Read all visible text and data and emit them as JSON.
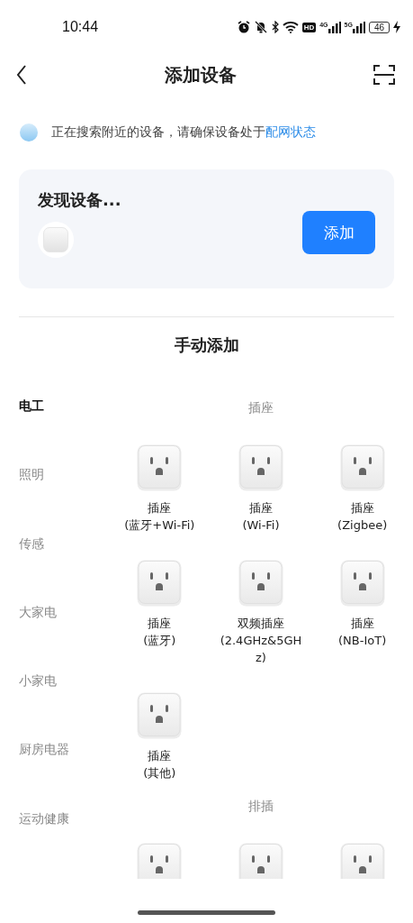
{
  "status_bar": {
    "time": "10:44",
    "hd": "HD",
    "net_1": "4G",
    "net_2": "5G",
    "battery": "46"
  },
  "nav": {
    "title": "添加设备"
  },
  "search": {
    "text": "正在搜索附近的设备，请确保设备处于",
    "link": "配网状态"
  },
  "discover": {
    "title": "发现设备...",
    "button": "添加"
  },
  "manual": {
    "title": "手动添加"
  },
  "categories": [
    {
      "label": "电工",
      "selected": true
    },
    {
      "label": "照明",
      "selected": false
    },
    {
      "label": "传感",
      "selected": false
    },
    {
      "label": "大家电",
      "selected": false
    },
    {
      "label": "小家电",
      "selected": false
    },
    {
      "label": "厨房电器",
      "selected": false
    },
    {
      "label": "运动健康",
      "selected": false
    }
  ],
  "sections": [
    {
      "title": "插座",
      "items": [
        {
          "name": "插座",
          "sub": "(蓝牙+Wi-Fi)"
        },
        {
          "name": "插座",
          "sub": "(Wi-Fi)"
        },
        {
          "name": "插座",
          "sub": "(Zigbee)"
        },
        {
          "name": "插座",
          "sub": "(蓝牙)"
        },
        {
          "name": "双频插座",
          "sub": "(2.4GHz&5GHz)"
        },
        {
          "name": "插座",
          "sub": "(NB-IoT)"
        },
        {
          "name": "插座",
          "sub": "(其他)"
        }
      ]
    },
    {
      "title": "排插",
      "items": [
        {
          "kind": "socket"
        },
        {
          "kind": "socket"
        },
        {
          "kind": "socket"
        }
      ]
    }
  ]
}
